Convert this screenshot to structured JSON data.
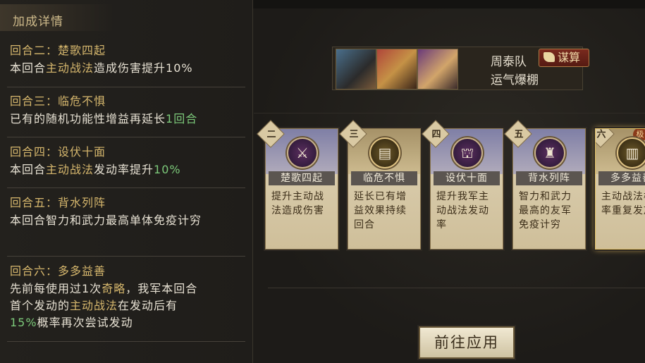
{
  "left_panel": {
    "title": "加成详情",
    "entries": [
      {
        "head": "回合二：楚歌四起",
        "body_pre": "本回合",
        "body_hl1": "主动战法",
        "body_post": "造成伤害提升10%"
      },
      {
        "head": "回合三：临危不惧",
        "body_pre": "已有的随机功能性增益再延长",
        "body_hl_green": "1回合"
      },
      {
        "head": "回合四：设伏十面",
        "body_pre": "本回合",
        "body_hl1": "主动战法",
        "body_mid": "发动率提升",
        "body_hl_green": "10%"
      },
      {
        "head": "回合五：背水列阵",
        "body": "本回合智力和武力最高单体免疫计穷"
      },
      {
        "head": "回合六：多多益善",
        "line1_pre": "先前每使用过1次",
        "line1_hl": "奇略",
        "line1_post": "，我军本回合",
        "line2_pre": "首个发动的",
        "line2_hl": "主动战法",
        "line2_post": "在发动后有",
        "line3_hl_green": "15%",
        "line3_post": "概率再次尝试发动"
      }
    ]
  },
  "team": {
    "name": "周泰队",
    "badge": "谋算",
    "subtitle": "运气爆棚"
  },
  "cards": [
    {
      "num": "二",
      "name": "楚歌四起",
      "desc": "提升主动战法造成伤害",
      "icon": "sword-strike-icon",
      "icon_glyph": "⚔"
    },
    {
      "num": "三",
      "name": "临危不惧",
      "desc": "延长已有增益效果持续回合",
      "icon": "scroll-icon",
      "icon_glyph": "▤"
    },
    {
      "num": "四",
      "name": "设伏十面",
      "desc": "提升我军主动战法发动率",
      "icon": "ambush-icon",
      "icon_glyph": "⛫"
    },
    {
      "num": "五",
      "name": "背水列阵",
      "desc": "智力和武力最高的友军免疫计穷",
      "icon": "warrior-icon",
      "icon_glyph": "♜"
    },
    {
      "num": "六",
      "name": "多多益善",
      "desc": "主动战法概率重复发放",
      "icon": "scrolls-icon",
      "icon_glyph": "▥",
      "tag": "极"
    }
  ],
  "apply_button": "前往应用"
}
